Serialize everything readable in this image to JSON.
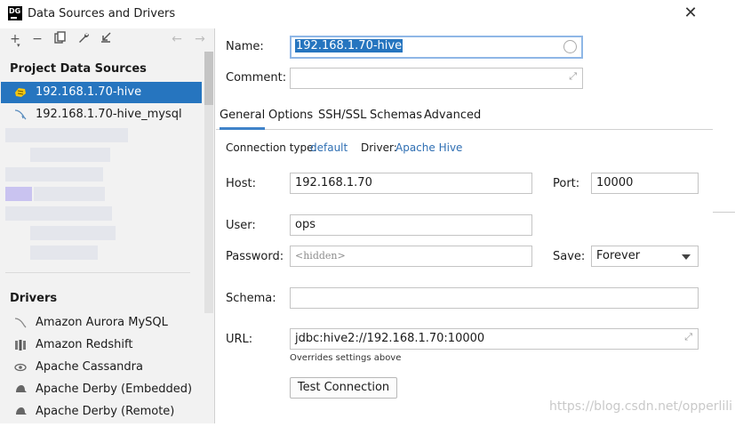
{
  "window": {
    "title": "Data Sources and Drivers",
    "app_icon_text": "DG"
  },
  "toolbar": {
    "add_icon": "+",
    "remove_icon": "−",
    "copy_icon": "⧉",
    "settings_icon": "wrench",
    "import_icon": "↙",
    "back_icon": "←",
    "forward_icon": "→"
  },
  "sidebar": {
    "project_title": "Project Data Sources",
    "sources": [
      {
        "label": "192.168.1.70-hive",
        "selected": true,
        "icon": "hive-icon"
      },
      {
        "label": "192.168.1.70-hive_mysql",
        "selected": false,
        "icon": "mysql-icon"
      }
    ],
    "drivers_title": "Drivers",
    "drivers": [
      {
        "label": "Amazon Aurora MySQL",
        "icon": "aurora-mysql-icon"
      },
      {
        "label": "Amazon Redshift",
        "icon": "redshift-icon"
      },
      {
        "label": "Apache Cassandra",
        "icon": "cassandra-icon"
      },
      {
        "label": "Apache Derby (Embedded)",
        "icon": "derby-icon"
      },
      {
        "label": "Apache Derby (Remote)",
        "icon": "derby-icon"
      }
    ]
  },
  "form": {
    "name_label": "Name:",
    "name_value": "192.168.1.70-hive",
    "comment_label": "Comment:",
    "comment_value": "",
    "tabs": [
      "General",
      "Options",
      "SSH/SSL",
      "Schemas",
      "Advanced"
    ],
    "active_tab": "General",
    "connection_type_label": "Connection type:",
    "connection_type_value": "default",
    "driver_label": "Driver:",
    "driver_value": "Apache Hive",
    "host_label": "Host:",
    "host_value": "192.168.1.70",
    "port_label": "Port:",
    "port_value": "10000",
    "user_label": "User:",
    "user_value": "ops",
    "password_label": "Password:",
    "password_placeholder": "<hidden>",
    "save_label": "Save:",
    "save_value": "Forever",
    "schema_label": "Schema:",
    "schema_value": "",
    "url_label": "URL:",
    "url_value": "jdbc:hive2://192.168.1.70:10000",
    "url_note": "Overrides settings above",
    "test_button": "Test Connection"
  },
  "watermark": "https://blog.csdn.net/opperlili"
}
